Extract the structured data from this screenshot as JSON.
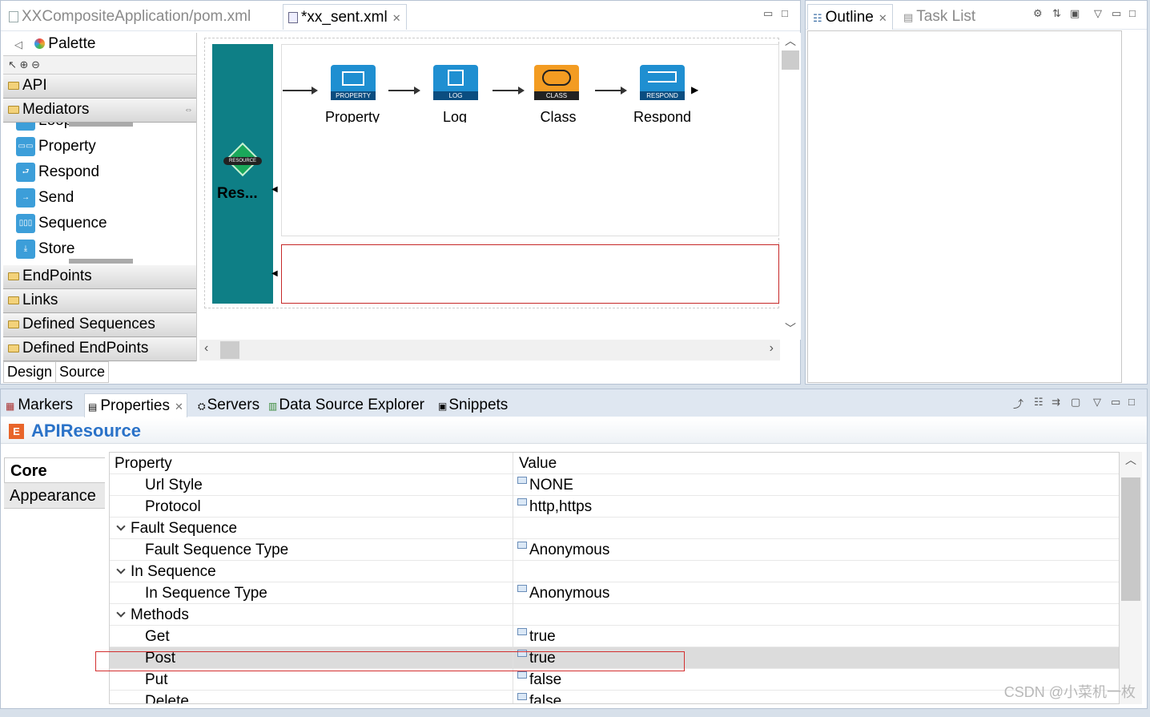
{
  "editor": {
    "tabs": [
      {
        "label": "XXCompositeApplication/pom.xml",
        "active": false
      },
      {
        "label": "*xx_sent.xml",
        "active": true
      }
    ]
  },
  "palette": {
    "title": "Palette",
    "drawers": {
      "api": "API",
      "mediators": "Mediators",
      "endpoints": "EndPoints",
      "links": "Links",
      "defined_sequences": "Defined Sequences",
      "defined_endpoints": "Defined EndPoints"
    },
    "mediators": [
      {
        "label": "Loopback",
        "icon": "loopback-icon"
      },
      {
        "label": "Property",
        "icon": "property-icon"
      },
      {
        "label": "Respond",
        "icon": "respond-icon"
      },
      {
        "label": "Send",
        "icon": "send-icon"
      },
      {
        "label": "Sequence",
        "icon": "sequence-icon"
      },
      {
        "label": "Store",
        "icon": "store-icon"
      }
    ],
    "bottom_tabs": [
      "Design",
      "Source"
    ]
  },
  "canvas": {
    "resource_label": "Res...",
    "resource_badge": "RESOURCE",
    "nodes": [
      {
        "label": "Property",
        "badge": "PROPERTY",
        "color": "#1f8fd1"
      },
      {
        "label": "Log",
        "badge": "LOG",
        "color": "#1f8fd1"
      },
      {
        "label": "Class",
        "badge": "CLASS",
        "color": "#f39c22"
      },
      {
        "label": "Respond",
        "badge": "RESPOND",
        "color": "#1f8fd1"
      }
    ]
  },
  "side": {
    "tabs": [
      {
        "label": "Outline",
        "active": true
      },
      {
        "label": "Task List",
        "active": false
      }
    ]
  },
  "bottom": {
    "tabs": [
      "Markers",
      "Properties",
      "Servers",
      "Data Source Explorer",
      "Snippets"
    ],
    "title": "APIResource",
    "side_tabs": [
      "Core",
      "Appearance"
    ],
    "columns": [
      "Property",
      "Value"
    ],
    "rows": [
      {
        "key": "Url Style",
        "value": "NONE",
        "level": 1
      },
      {
        "key": "Protocol",
        "value": "http,https",
        "level": 1
      },
      {
        "key": "Fault Sequence",
        "value": "",
        "level": 0
      },
      {
        "key": "Fault Sequence Type",
        "value": "Anonymous",
        "level": 1
      },
      {
        "key": "In Sequence",
        "value": "",
        "level": 0
      },
      {
        "key": "In Sequence Type",
        "value": "Anonymous",
        "level": 1
      },
      {
        "key": "Methods",
        "value": "",
        "level": 0
      },
      {
        "key": "Get",
        "value": "true",
        "level": 1
      },
      {
        "key": "Post",
        "value": "true",
        "level": 1,
        "selected": true
      },
      {
        "key": "Put",
        "value": "false",
        "level": 1
      },
      {
        "key": "Delete",
        "value": "false",
        "level": 1
      }
    ],
    "highlight_color": "#d32f2f"
  },
  "watermark": "CSDN @小菜机一枚"
}
